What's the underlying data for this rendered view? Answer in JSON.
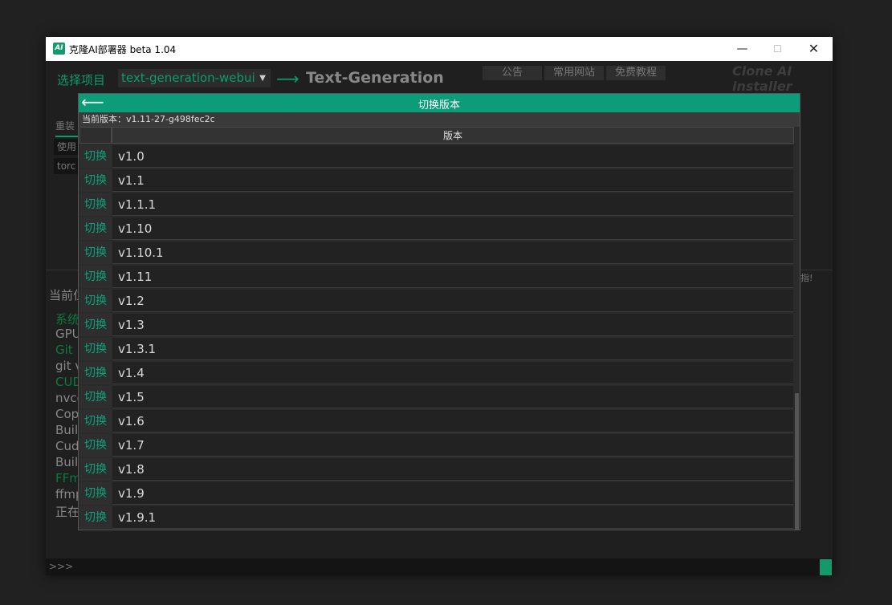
{
  "window": {
    "title": "克隆AI部署器 beta 1.04",
    "icon_text": "AI"
  },
  "background": {
    "select_project_label": "选择项目",
    "project_value": "text-generation-webui",
    "heading": "Text-Generation",
    "tabs": [
      "公告",
      "常用网站",
      "免费教程"
    ],
    "brand": "Clone AI installer",
    "left_tab": "重装",
    "left_items": [
      "使用",
      "torc"
    ],
    "right_fragment": "指!",
    "status_label": "当前位",
    "log_lines": [
      {
        "text": "系统",
        "color": "#0b7a3f"
      },
      {
        "text": "GPU",
        "color": "#888888"
      },
      {
        "text": "Git",
        "color": "#0b7a3f"
      },
      {
        "text": "git v",
        "color": "#888888"
      },
      {
        "text": "CUD",
        "color": "#0b7a3f"
      },
      {
        "text": "nvcc",
        "color": "#888888"
      },
      {
        "text": "Cop",
        "color": "#888888"
      },
      {
        "text": "Built",
        "color": "#888888"
      },
      {
        "text": "Cuda",
        "color": "#888888"
      },
      {
        "text": "Build",
        "color": "#888888"
      },
      {
        "text": "FFm",
        "color": "#0b7a3f"
      },
      {
        "text": "ffmp",
        "color": "#888888"
      },
      {
        "text": "正在",
        "color": "#888888"
      }
    ],
    "console_prompt": ">>>"
  },
  "dialog": {
    "title": "切换版本",
    "current_version": "当前版本：v1.11-27-g498fec2c",
    "column_header": "版本",
    "switch_label": "切换",
    "versions": [
      "v1.0",
      "v1.1",
      "v1.1.1",
      "v1.10",
      "v1.10.1",
      "v1.11",
      "v1.2",
      "v1.3",
      "v1.3.1",
      "v1.4",
      "v1.5",
      "v1.6",
      "v1.7",
      "v1.8",
      "v1.9",
      "v1.9.1"
    ]
  },
  "colors": {
    "accent": "#0c9c78",
    "accent_text": "#0ca37c",
    "background": "#1f1f1f"
  }
}
